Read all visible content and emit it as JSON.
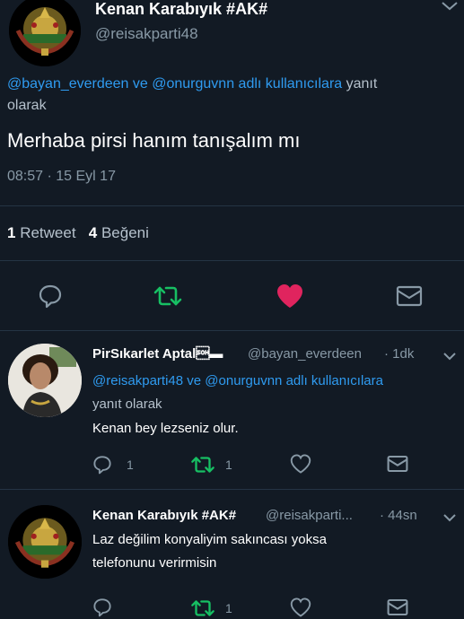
{
  "main_tweet": {
    "author_name": "Kenan Karabıyık #AK#",
    "handle": "@reisakparti48",
    "reply_mentions": "@bayan_everdeen ve @onurguvnn adlı kullanıcılara",
    "reply_suffix_1": "yanıt",
    "reply_suffix_2": "olarak",
    "text": "Merhaba pirsi hanım tanışalım mı",
    "timestamp": "08:57 · 15 Eyl 17",
    "retweet_count": "1",
    "retweet_label": "Retweet",
    "like_count": "4",
    "like_label": "Beğeni"
  },
  "replies": [
    {
      "author_name": "PirSıkarlet Aptal\u0001▬",
      "handle": "@bayan_everdeen",
      "time": "· 1dk",
      "mention_line": "@reisakparti48 ve @onurguvnn adlı kullanıcılara",
      "reply_label": "yanıt olarak",
      "text_line_1": "Kenan bey lezseniz olur.",
      "reply_count": "1",
      "retweet_count": "1"
    },
    {
      "author_name": "Kenan Karabıyık #AK#",
      "handle": "@reisakparti...",
      "time": "· 44sn",
      "text_line_1": "Laz değilim konyaliyim sakıncası yoksa",
      "text_line_2": "telefonunu verirmisin",
      "reply_count": "",
      "retweet_count": "1"
    }
  ],
  "colors": {
    "background": "#121a24",
    "link": "#2f9bf0",
    "muted": "#8899a6",
    "retweet_green": "#17bf63",
    "like_red": "#e0245e"
  },
  "icons": [
    "ottoman-emblem-avatar",
    "chevron-down-icon",
    "reply-icon",
    "retweet-icon",
    "heart-icon",
    "envelope-icon"
  ]
}
